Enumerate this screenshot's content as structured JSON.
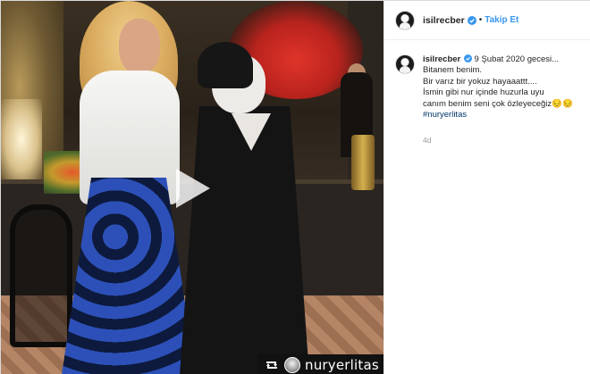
{
  "post": {
    "header": {
      "username": "isilrecber",
      "separator": "•",
      "follow_label": "Takip Et"
    },
    "caption": {
      "username": "isilrecber",
      "date": "9 Şubat 2020 gecesi...",
      "lines": [
        "Bitanem benim.",
        "Bir varız bir yokuz hayaaattt....",
        "İsmin gibi nur içinde huzurla uyu",
        "canım benim seni çok özleyeceğiz😔😔"
      ],
      "hashtag": "#nuryerlitas"
    },
    "timestamp": "4d"
  },
  "media": {
    "type": "video",
    "repost_credit": "nuryerlitas"
  },
  "colors": {
    "link_blue": "#3897f0",
    "hashtag": "#003569",
    "verified": "#3897f0",
    "muted": "#999999"
  },
  "icons": {
    "play": "play-icon",
    "verified": "verified-badge-icon",
    "repost": "repost-icon"
  }
}
